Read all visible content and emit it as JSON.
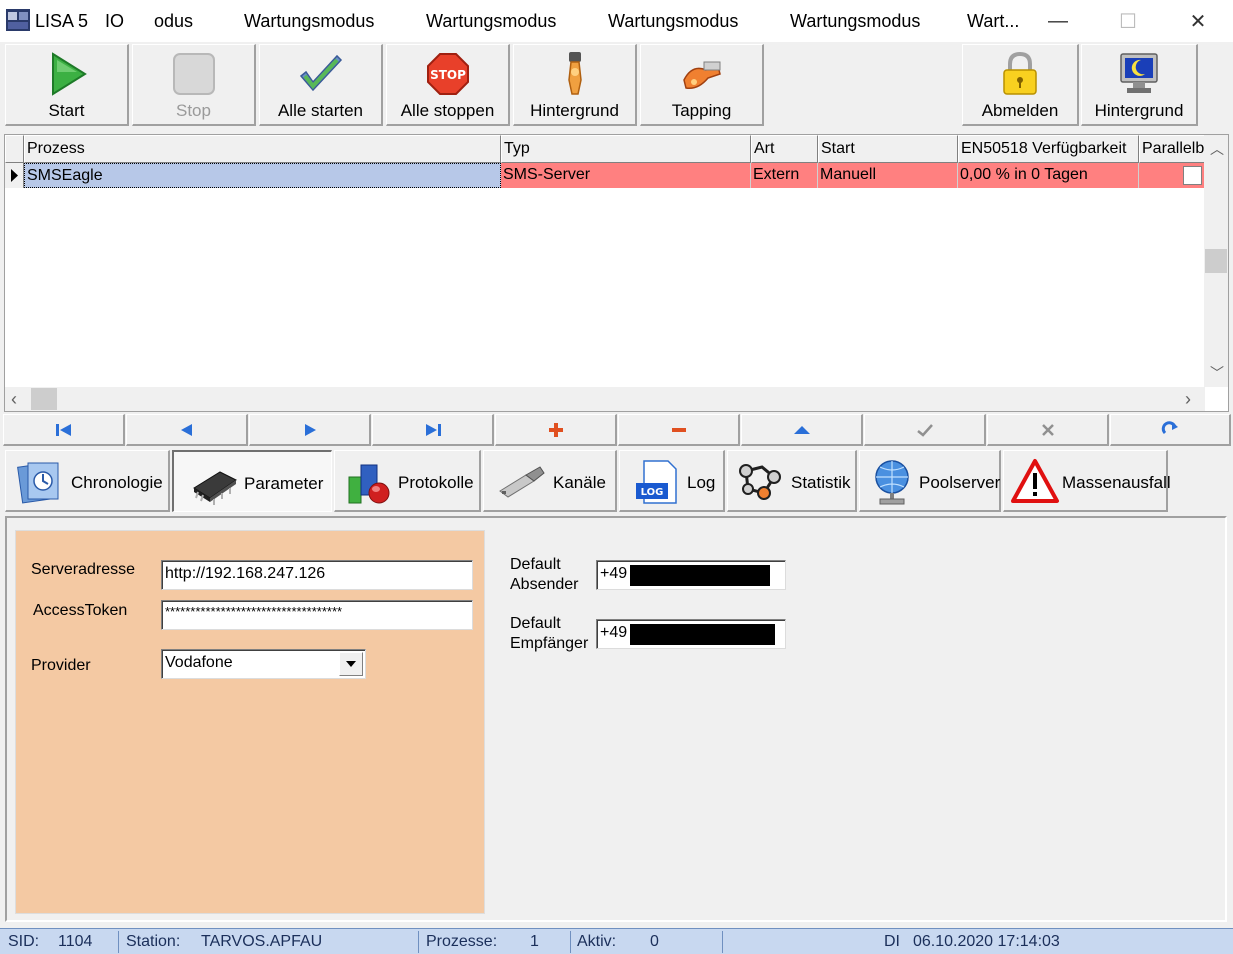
{
  "titlebar": {
    "app_name": "LISA 5",
    "items": [
      "IO",
      "odus",
      "Wartungsmodus",
      "Wartungsmodus",
      "Wartungsmodus",
      "Wartungsmodus",
      "Wart..."
    ],
    "minimize": "—",
    "maximize": "☐",
    "close": "✕"
  },
  "toolbar": {
    "start": "Start",
    "stop": "Stop",
    "start_all": "Alle starten",
    "stop_all": "Alle stoppen",
    "background": "Hintergrund",
    "tapping": "Tapping",
    "logout": "Abmelden",
    "background2": "Hintergrund",
    "stop_sign_text": "STOP"
  },
  "grid": {
    "columns": [
      "Prozess",
      "Typ",
      "Art",
      "Start",
      "EN50518 Verfügbarkeit",
      "Parallelb"
    ],
    "rows": [
      {
        "prozess": "SMSEagle",
        "typ": "SMS-Server",
        "art": "Extern",
        "start": "Manuell",
        "verfuegbarkeit": "0,00 % in 0 Tagen",
        "parallel": false
      }
    ],
    "row_color": "#ff8080",
    "selected_color": "#b7c8e8"
  },
  "tabs": [
    {
      "label": "Chronologie",
      "icon": "chronology-icon"
    },
    {
      "label": "Parameter",
      "icon": "chip-icon"
    },
    {
      "label": "Protokolle",
      "icon": "protocol-icon"
    },
    {
      "label": "Kanäle",
      "icon": "usb-icon"
    },
    {
      "label": "Log",
      "icon": "log-icon",
      "icon_text": "LOG"
    },
    {
      "label": "Statistik",
      "icon": "statistics-icon"
    },
    {
      "label": "Poolserver",
      "icon": "globe-icon"
    },
    {
      "label": "Massenausfall",
      "icon": "warning-icon"
    }
  ],
  "form": {
    "server_label": "Serveradresse",
    "server_value": "http://192.168.247.126",
    "token_label": "AccessToken",
    "token_value": "***********************************",
    "provider_label": "Provider",
    "provider_value": "Vodafone",
    "sender_label_1": "Default",
    "sender_label_2": "Absender",
    "sender_value": "+49",
    "recipient_label_1": "Default",
    "recipient_label_2": "Empfänger",
    "recipient_value": "+49",
    "panel_color": "#f4c9a3"
  },
  "status": {
    "sid_label": "SID:",
    "sid_value": "1104",
    "station_label": "Station:",
    "station_value": "TARVOS.APFAU",
    "processes_label": "Prozesse:",
    "processes_value": "1",
    "active_label": "Aktiv:",
    "active_value": "0",
    "day": "DI",
    "datetime": "06.10.2020 17:14:03"
  }
}
